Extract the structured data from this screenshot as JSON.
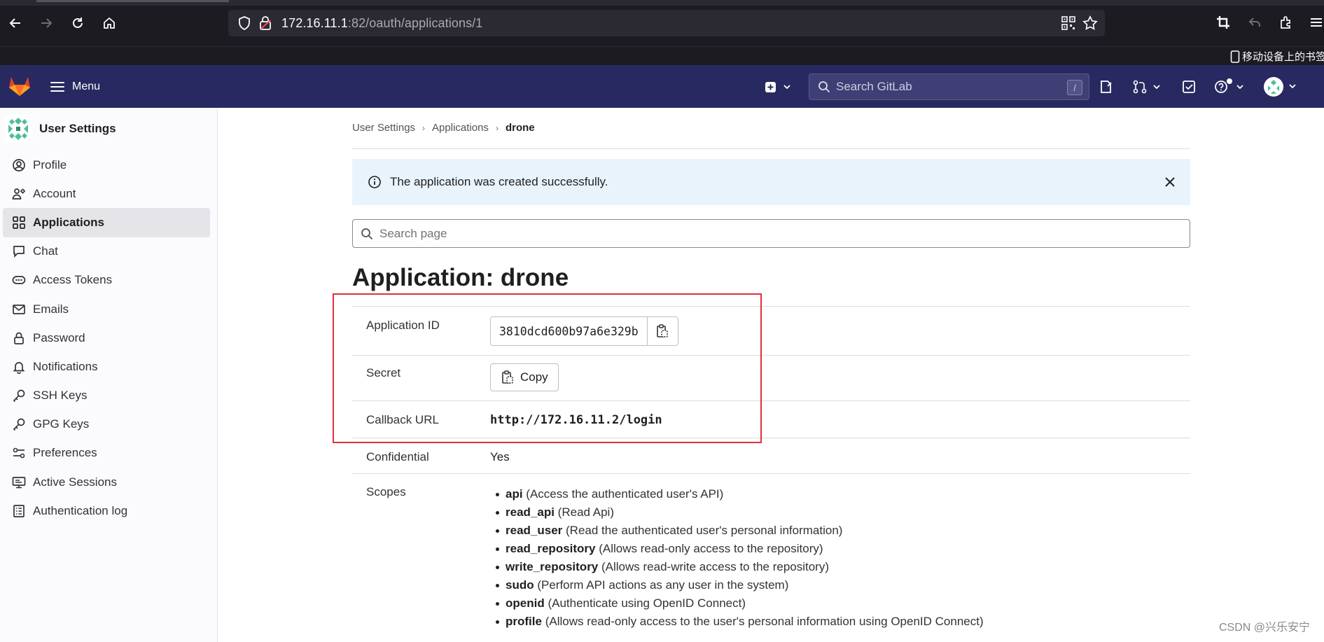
{
  "browser": {
    "url_host": "172.16.11.1",
    "url_rest": ":82/oauth/applications/1",
    "mobile_bookmarks": "移动设备上的书签"
  },
  "header": {
    "menu_label": "Menu",
    "search_placeholder": "Search GitLab",
    "search_shortcut": "/"
  },
  "sidebar": {
    "title": "User Settings",
    "items": [
      {
        "label": "Profile",
        "icon": "profile-icon"
      },
      {
        "label": "Account",
        "icon": "account-icon"
      },
      {
        "label": "Applications",
        "icon": "applications-icon",
        "active": true
      },
      {
        "label": "Chat",
        "icon": "chat-icon"
      },
      {
        "label": "Access Tokens",
        "icon": "token-icon"
      },
      {
        "label": "Emails",
        "icon": "mail-icon"
      },
      {
        "label": "Password",
        "icon": "lock-icon"
      },
      {
        "label": "Notifications",
        "icon": "bell-icon"
      },
      {
        "label": "SSH Keys",
        "icon": "key-icon"
      },
      {
        "label": "GPG Keys",
        "icon": "key-icon"
      },
      {
        "label": "Preferences",
        "icon": "preferences-icon"
      },
      {
        "label": "Active Sessions",
        "icon": "monitor-icon"
      },
      {
        "label": "Authentication log",
        "icon": "log-icon"
      }
    ]
  },
  "breadcrumb": [
    "User Settings",
    "Applications",
    "drone"
  ],
  "alert": {
    "message": "The application was created successfully."
  },
  "page_search": {
    "placeholder": "Search page"
  },
  "page_title": "Application: drone",
  "details": {
    "app_id_label": "Application ID",
    "app_id_value": "3810dcd600b97a6e329b",
    "secret_label": "Secret",
    "secret_button": "Copy",
    "callback_label": "Callback URL",
    "callback_value": "http://172.16.11.2/login",
    "confidential_label": "Confidential",
    "confidential_value": "Yes",
    "scopes_label": "Scopes"
  },
  "scopes": [
    {
      "name": "api",
      "desc": "(Access the authenticated user's API)"
    },
    {
      "name": "read_api",
      "desc": "(Read Api)"
    },
    {
      "name": "read_user",
      "desc": "(Read the authenticated user's personal information)"
    },
    {
      "name": "read_repository",
      "desc": "(Allows read-only access to the repository)"
    },
    {
      "name": "write_repository",
      "desc": "(Allows read-write access to the repository)"
    },
    {
      "name": "sudo",
      "desc": "(Perform API actions as any user in the system)"
    },
    {
      "name": "openid",
      "desc": "(Authenticate using OpenID Connect)"
    },
    {
      "name": "profile",
      "desc": "(Allows read-only access to the user's personal information using OpenID Connect)"
    }
  ],
  "watermark": "CSDN @兴乐安宁",
  "colors": {
    "header_bg": "#292961",
    "annotation_red": "#e0313c",
    "alert_bg": "#e9f3fc"
  }
}
